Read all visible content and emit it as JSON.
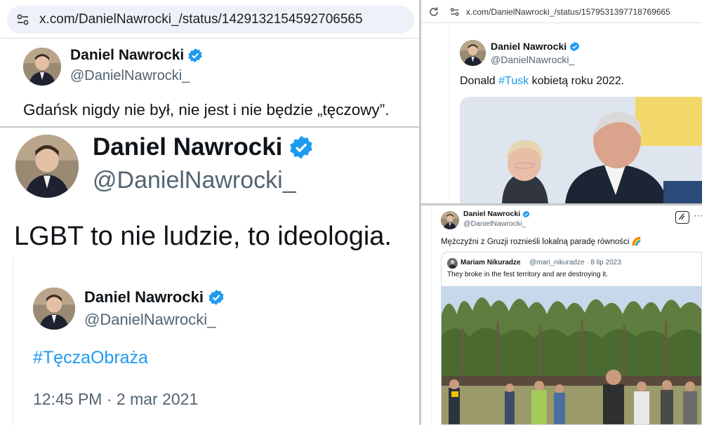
{
  "tweet1": {
    "url": "x.com/DanielNawrocki_/status/1429132154592706565",
    "name": "Daniel Nawrocki",
    "handle": "@DanielNawrocki_",
    "text": "Gdańsk nigdy nie był, nie jest i nie będzie „tęczowy”."
  },
  "tweet2": {
    "name": "Daniel Nawrocki",
    "handle": "@DanielNawrocki_",
    "text": "LGBT to nie ludzie, to ideologia."
  },
  "tweet3": {
    "name": "Daniel Nawrocki",
    "handle": "@DanielNawrocki_",
    "hashtag": "#TęczaObraża",
    "timestamp": "12:45 PM · 2 mar 2021"
  },
  "tweet4": {
    "url": "x.com/DanielNawrocki_/status/1579531397718769665",
    "name": "Daniel Nawrocki",
    "handle": "@DanielNawrocki_",
    "text_before": "Donald ",
    "hashtag": "#Tusk",
    "text_after": " kobietą roku 2022."
  },
  "tweet5": {
    "name": "Daniel Nawrocki",
    "handle": "@DanielNawrocki_",
    "text": "Mężczyźni z Gruzji roznieśli lokalną paradę równości",
    "emoji": "🌈",
    "quoted": {
      "name": "Mariam Nikuradze",
      "meta": "@mari_nikuradze · 8 lip 2023",
      "text": "They broke in the fest territory and are destroying it."
    }
  },
  "icons": {
    "verified": "verified-badge-icon",
    "site_settings": "site-settings-icon",
    "reload": "reload-icon",
    "grok": "grok-icon",
    "more": "more-icon"
  },
  "colors": {
    "link": "#1d9bf0",
    "handle": "#536471",
    "text": "#0f1419"
  }
}
